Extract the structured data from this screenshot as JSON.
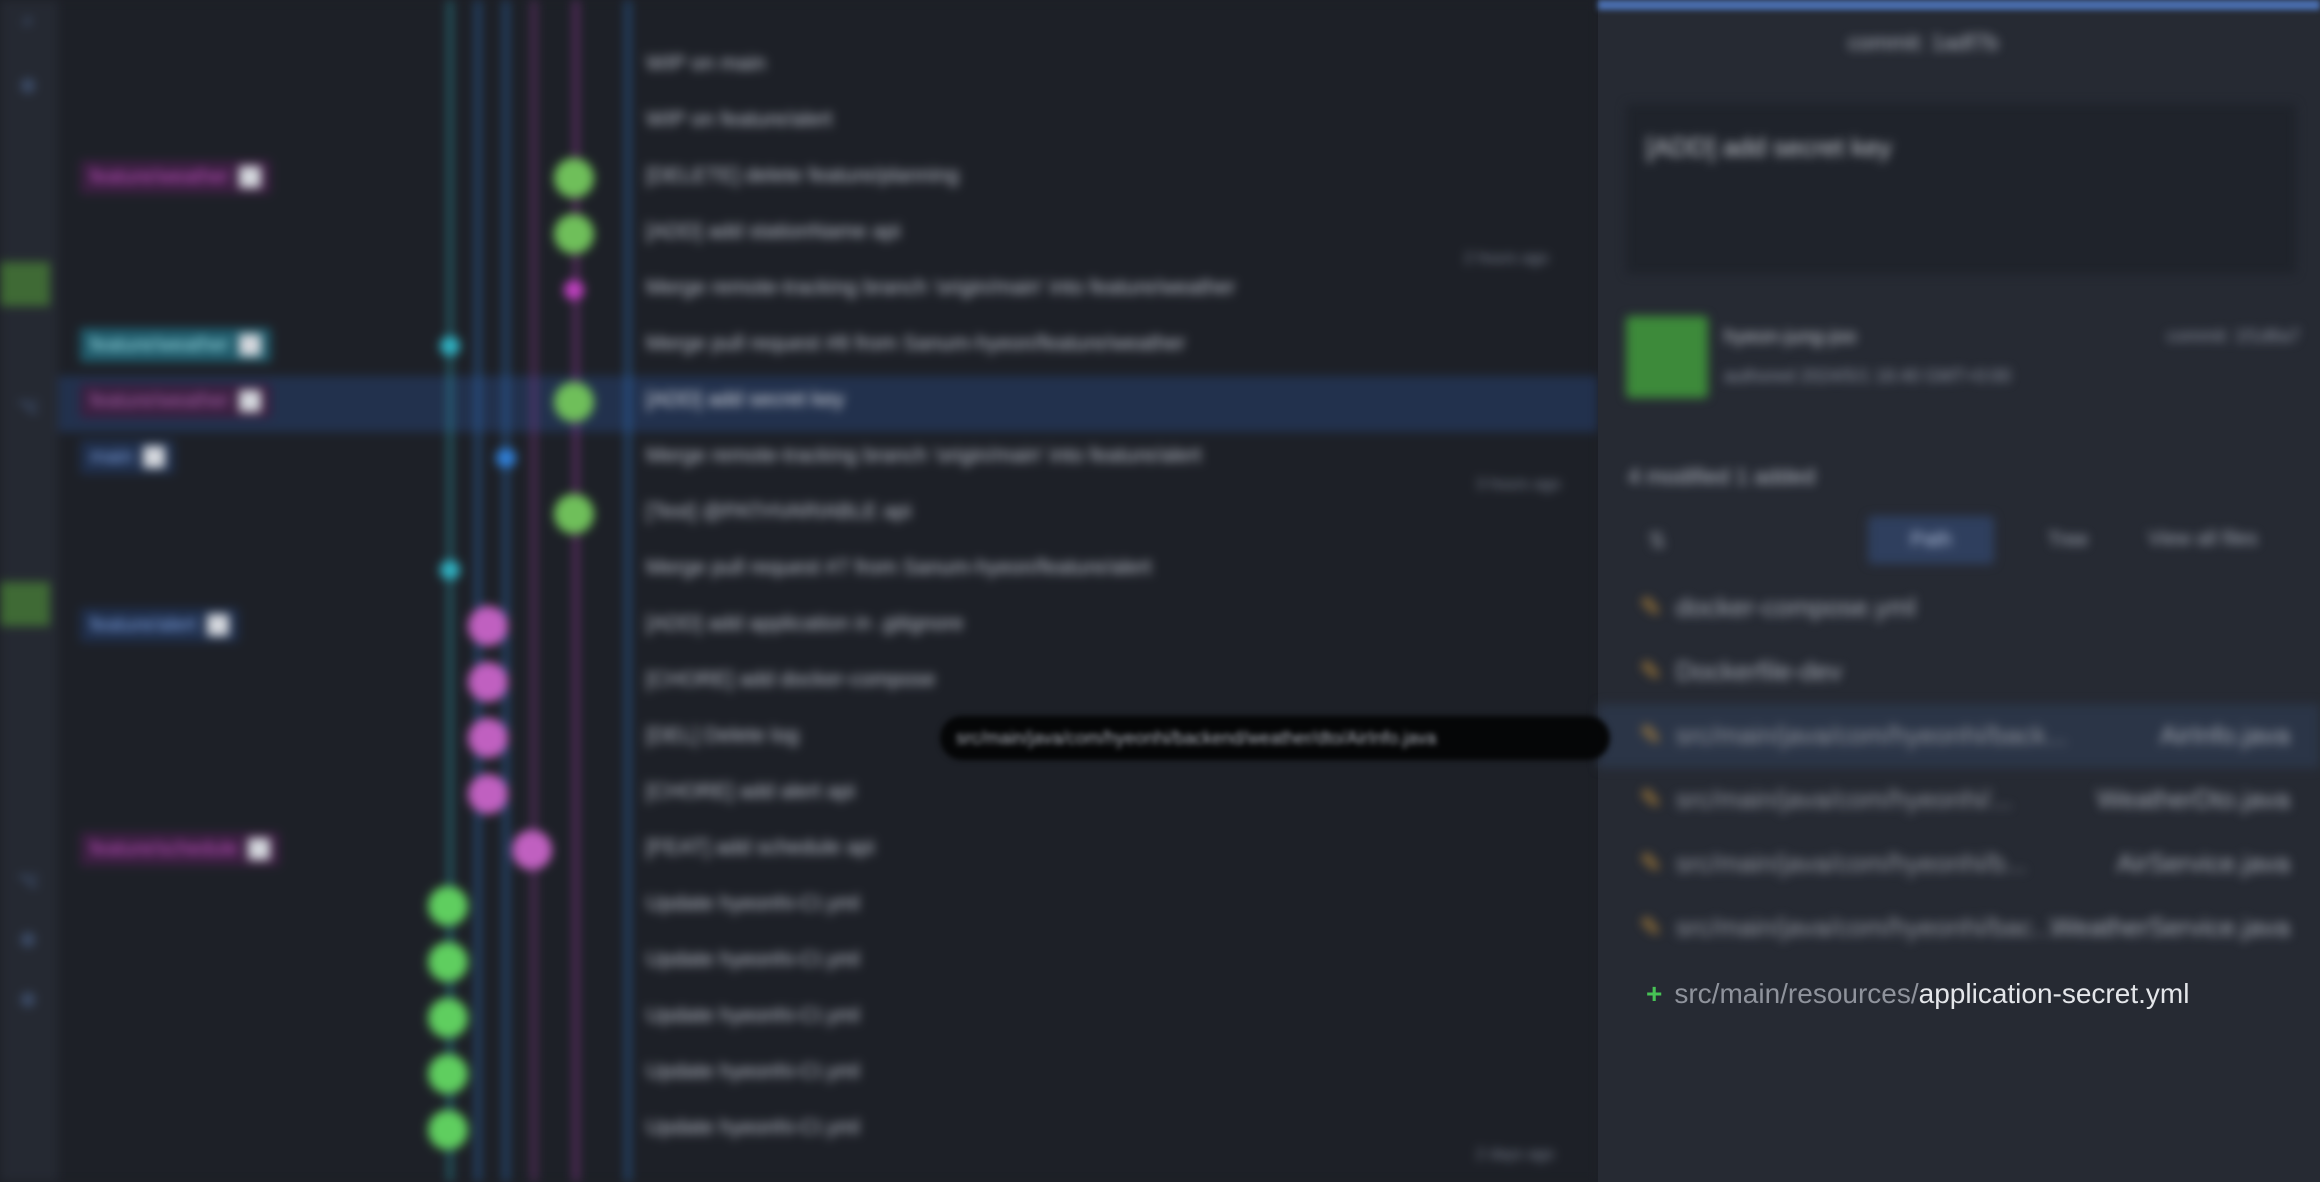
{
  "graph": {
    "refs": [
      {
        "label": "feature/weather",
        "color": "#9c2f9c",
        "bg": "#3a1f40"
      },
      {
        "label": "feature/weather",
        "color": "#35b4c4",
        "bg": "#1f5060"
      },
      {
        "label": "feature/weather",
        "color": "#8c3f8c",
        "bg": "#3a1f40"
      },
      {
        "label": "main",
        "color": "#3a6ec4",
        "bg": "#1f2e4a"
      },
      {
        "label": "feature/alert",
        "color": "#3a6ec4",
        "bg": "#1f2e4a"
      },
      {
        "label": "feature/schedule",
        "color": "#b03fb0",
        "bg": "#3a1f40"
      }
    ],
    "commits": [
      "WIP on main",
      "WIP on feature/alert",
      "[DELETE] delete feature/planning",
      "[ADD] add stationName api",
      "Merge remote-tracking branch 'origin/main' into feature/weather",
      "Merge pull request #8 from Sanum-hyeon/feature/weather",
      "[ADD] add secret key",
      "Merge remote-tracking branch 'origin/main' into feature/alert",
      "[Test] @PATHVARIABLE api",
      "Merge pull request #7 from Sanum-hyeon/feature/alert",
      "[ADD] add application in .gitignore",
      "[CHORE] add docker-compose",
      "[DEL] Delete log",
      "[CHORE] add alert api",
      "[FEAT] add schedule api",
      "Update hyeonhi-CI.yml",
      "Update hyeonhi-CI.yml",
      "Update hyeonhi-CI.yml",
      "Update hyeonhi-CI.yml",
      "Update hyeonhi-CI.yml"
    ],
    "times": [
      "2 hours ago",
      "3 hours ago",
      "2 days ago"
    ],
    "tooltip": "src/main/java/com/hyeonhi/backend/weather/dto/AirInfo.java"
  },
  "panel": {
    "commit_header": "commit: 1adf7b",
    "message": "[ADD] add secret key",
    "author": "hyeon-jung-joo",
    "authored": "authored 2024/5/1 16:40 GMT+0:00",
    "commit_sha": "commit: 1f1d6a7",
    "stats": "4 modified   1 added",
    "path_label": "Path",
    "tree_label": "Tree",
    "view_all": "View all files",
    "files": [
      {
        "dir": "",
        "name": "docker-compose.yml"
      },
      {
        "dir": "",
        "name": "Dockerfile-dev"
      },
      {
        "dir": "src/main/java/com/hyeonhi/back...",
        "name": "AirInfo.java"
      },
      {
        "dir": "src/main/java/com/hyeonhi/...",
        "name": "WeatherDto.java"
      },
      {
        "dir": "src/main/java/com/hyeonhi/b...",
        "name": "AirService.java"
      },
      {
        "dir": "src/main/java/com/hyeonhi/bac...",
        "name": "WeatherService.java"
      }
    ],
    "added_file": {
      "dir": "src/main/resources/",
      "name": "application-secret.yml"
    }
  },
  "colors": {
    "accent": "#4a6fb0",
    "added": "#47c255",
    "modified": "#d49a3b"
  }
}
